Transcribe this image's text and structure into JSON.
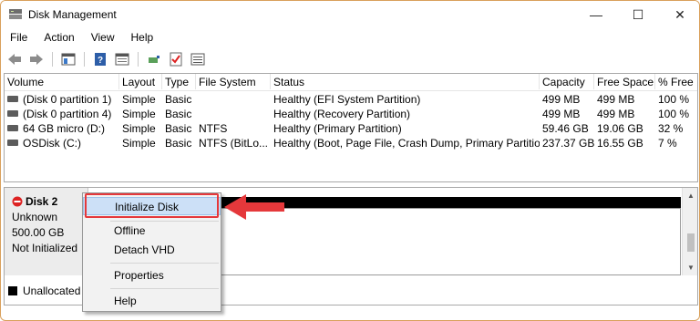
{
  "window": {
    "title": "Disk Management",
    "minimize_glyph": "—",
    "maximize_glyph": "☐",
    "close_glyph": "✕"
  },
  "menu": [
    "File",
    "Action",
    "View",
    "Help"
  ],
  "toolbar": {
    "icons": [
      "back-arrow-icon",
      "forward-arrow-icon",
      "console-tree-icon",
      "help-icon",
      "properties-icon",
      "connect-icon",
      "checklist-icon",
      "list-view-icon"
    ]
  },
  "volume_table": {
    "columns": [
      "Volume",
      "Layout",
      "Type",
      "File System",
      "Status",
      "Capacity",
      "Free Space",
      "% Free"
    ],
    "rows": [
      [
        "(Disk 0 partition 1)",
        "Simple",
        "Basic",
        "",
        "Healthy (EFI System Partition)",
        "499 MB",
        "499 MB",
        "100 %"
      ],
      [
        "(Disk 0 partition 4)",
        "Simple",
        "Basic",
        "",
        "Healthy (Recovery Partition)",
        "499 MB",
        "499 MB",
        "100 %"
      ],
      [
        "64 GB micro (D:)",
        "Simple",
        "Basic",
        "NTFS",
        "Healthy (Primary Partition)",
        "59.46 GB",
        "19.06 GB",
        "32 %"
      ],
      [
        "OSDisk (C:)",
        "Simple",
        "Basic",
        "NTFS (BitLo...",
        "Healthy (Boot, Page File, Crash Dump, Primary Partition)",
        "237.37 GB",
        "16.55 GB",
        "7 %"
      ]
    ]
  },
  "disk": {
    "name": "Disk 2",
    "type": "Unknown",
    "size": "500.00 GB",
    "status": "Not Initialized"
  },
  "legend": {
    "unallocated": "Unallocated"
  },
  "context_menu": {
    "items": [
      "Initialize Disk",
      "Offline",
      "Detach VHD",
      "Properties",
      "Help"
    ]
  },
  "colors": {
    "highlight": "#cce0f7",
    "callout": "#e5383b"
  }
}
